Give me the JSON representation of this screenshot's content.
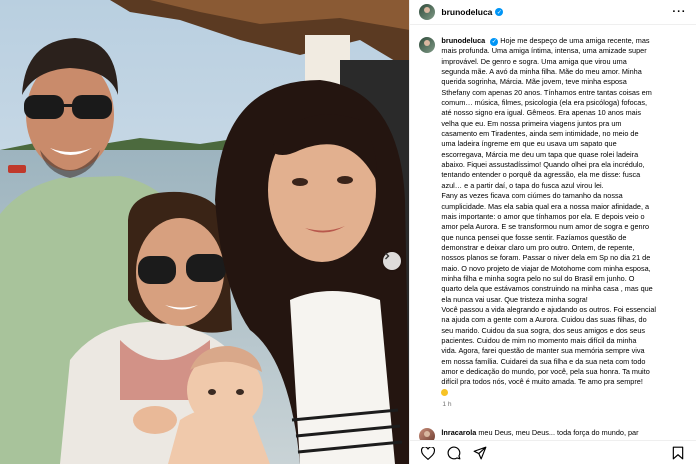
{
  "header": {
    "username": "brunodeluca",
    "verified_icon": "verified-badge-icon",
    "more_icon": "more-options-icon"
  },
  "caption": {
    "username": "brunodeluca",
    "lines": [
      "Hoje me despeço de uma amiga recente, mas",
      "mais profunda. Uma amiga íntima, intensa, uma amizade super",
      "improvável. De genro e sogra. Uma amiga que virou uma",
      "segunda mãe. A avó da minha filha. Mãe do meu amor. Minha",
      "querida sogrinha, Márcia. Mãe jovem, teve minha esposa",
      "Sthefany com apenas 20 anos. Tínhamos entre tantas coisas em",
      "comum… música, filmes, psicologia (ela era psicóloga) fofocas,",
      "até nosso signo era igual. Gêmeos. Era apenas 10 anos mais",
      "velha que eu. Em nossa primeira viagens juntos pra um",
      "casamento em Tiradentes, ainda sem intimidade, no meio de",
      "uma ladeira íngreme em que eu usava um sapato que",
      "escorregava, Márcia me deu um tapa que quase rolei ladeira",
      "abaixo. Fiquei assustadíssimo! Quando olhei pra ela incrédulo,",
      "tentando entender o porquê da agressão, ela me disse: fusca",
      "azul… e a partir daí, o tapa do fusca azul virou lei.",
      "Fany as vezes ficava com ciúmes do tamanho da nossa",
      "cumplicidade. Mas ela sabia qual era a nossa maior afinidade, a",
      "mais importante: o amor que tínhamos por ela. E depois veio o",
      "amor pela Aurora. E se transformou num amor de sogra e genro",
      "que nunca pensei que fosse sentir. Fazíamos questão de",
      "demonstrar e deixar claro um pro outro. Ontem, de repente,",
      "nossos planos se foram. Passar o niver dela em Sp no dia 21 de",
      "maio. O novo projeto de viajar de Motohome com minha esposa,",
      "minha filha e minha sogra pelo no sul do Brasil em junho. O",
      "quarto dela que estávamos construindo na minha casa , mas que",
      "ela nunca vai usar. Que tristeza minha sogra!",
      "Você passou a vida alegrando e ajudando os outros. Foi essencial",
      "na ajuda com a gente com a Aurora. Cuidou das suas filhas, do",
      "seu marido. Cuidou da sua sogra, dos seus amigos e dos seus",
      "pacientes. Cuidou de mim no momento mais difícil da minha",
      "vida. Agora, farei questão de manter sua memória sempre viva",
      "em nossa família. Cuidarei da sua filha e da sua neta com todo",
      "amor e dedicação do mundo, por você, pela sua honra. Ta muito",
      "difícil pra todos nós, você é muito amada. Te amo pra sempre!"
    ],
    "time": "1 h"
  },
  "comment": {
    "username": "lnracarola",
    "text": "meu Deus, meu Deus... toda força do mundo, par"
  },
  "actions": {
    "icons": [
      "heart-icon",
      "comment-icon",
      "share-icon",
      "bookmark-icon"
    ]
  },
  "photo": {
    "next_icon": "chevron-right-icon"
  }
}
